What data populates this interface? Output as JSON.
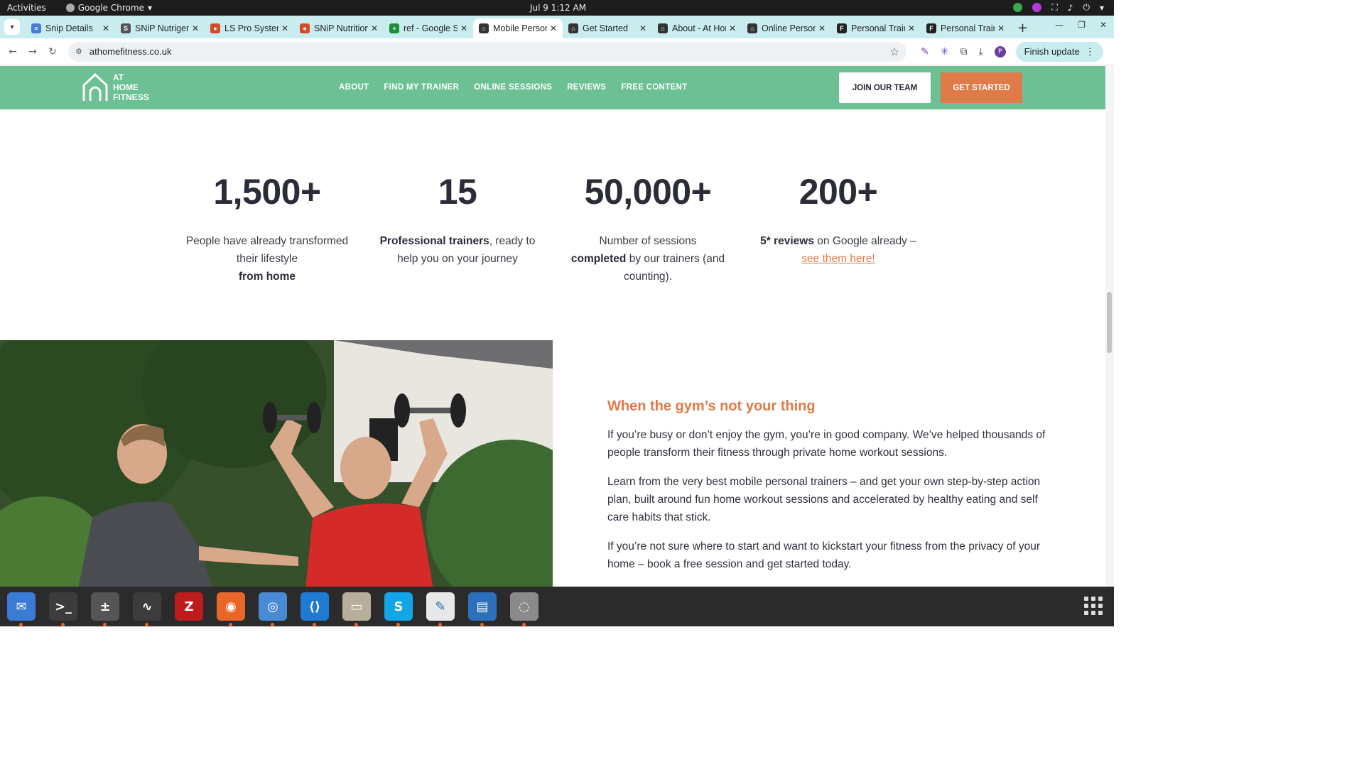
{
  "system": {
    "activities": "Activities",
    "app_name": "Google Chrome",
    "clock": "Jul 9  1:12 AM"
  },
  "tabs": [
    {
      "title": "Snip Details",
      "favicon_color": "#4a7bd4",
      "favicon_glyph": "≡"
    },
    {
      "title": "SNiP Nutrigenomics",
      "favicon_color": "#555555",
      "favicon_glyph": "S"
    },
    {
      "title": "LS Pro Systems",
      "favicon_color": "#d64a2a",
      "favicon_glyph": "●"
    },
    {
      "title": "SNiP Nutrition",
      "favicon_color": "#d64a2a",
      "favicon_glyph": "●"
    },
    {
      "title": "ref - Google Sheets",
      "favicon_color": "#1e8e3e",
      "favicon_glyph": "+"
    },
    {
      "title": "Mobile Personal",
      "favicon_color": "#333333",
      "favicon_glyph": "⌂",
      "active": true
    },
    {
      "title": "Get Started",
      "favicon_color": "#333333",
      "favicon_glyph": "⌂"
    },
    {
      "title": "About - At Home",
      "favicon_color": "#333333",
      "favicon_glyph": "⌂"
    },
    {
      "title": "Online Personal",
      "favicon_color": "#333333",
      "favicon_glyph": "⌂"
    },
    {
      "title": "Personal Trainer",
      "favicon_color": "#222222",
      "favicon_glyph": "F"
    },
    {
      "title": "Personal Trainer",
      "favicon_color": "#222222",
      "favicon_glyph": "F"
    }
  ],
  "browser": {
    "url": "athomefitness.co.uk",
    "finish_update": "Finish update",
    "profile_initial": "P"
  },
  "site": {
    "logo": {
      "line1": "AT",
      "line2": "HOME",
      "line3": "FITNESS"
    },
    "menu": [
      "ABOUT",
      "FIND MY TRAINER",
      "ONLINE SESSIONS",
      "REVIEWS",
      "FREE CONTENT"
    ],
    "join_button": "JOIN OUR TEAM",
    "start_button": "GET STARTED",
    "stats": [
      {
        "number": "1,500+",
        "pre": "People have already transformed their lifestyle",
        "bold": "from home",
        "post": ""
      },
      {
        "number": "15",
        "pre": "",
        "bold": "Professional trainers",
        "post": ", ready to help you on your journey"
      },
      {
        "number": "50,000+",
        "pre": "Number of sessions",
        "bold": "completed",
        "post": "by our trainers (and counting)."
      },
      {
        "number": "200+",
        "pre": "",
        "bold": "5* reviews",
        "post": "on Google already –",
        "link": "see them here!"
      }
    ],
    "section": {
      "heading": "When the gym’s not your thing",
      "p1": "If you’re busy or don’t enjoy the gym, you’re in good company. We’ve helped thousands of people transform their fitness through private home workout sessions.",
      "p2": "Learn from the very best mobile personal trainers – and get your own step-by-step action plan, built around fun home workout sessions and accelerated by healthy eating and self care habits that stick.",
      "p3": "If you’re not sure where to start and want to kickstart your fitness from the privacy of your home – book a free session and get started today."
    }
  },
  "dock": [
    {
      "name": "thunderbird",
      "color": "#3a7bd5",
      "glyph": "✉"
    },
    {
      "name": "terminal",
      "color": "#3c3c3c",
      "glyph": ">_"
    },
    {
      "name": "calculator",
      "color": "#555555",
      "glyph": "±"
    },
    {
      "name": "system-monitor",
      "color": "#3c3c3c",
      "glyph": "∿"
    },
    {
      "name": "filezilla",
      "color": "#bf1b1b",
      "glyph": "Z"
    },
    {
      "name": "firefox",
      "color": "#e8662a",
      "glyph": "◉"
    },
    {
      "name": "chrome",
      "color": "#4a8ad4",
      "glyph": "◎"
    },
    {
      "name": "vscode",
      "color": "#1f7ad4",
      "glyph": "⟨⟩"
    },
    {
      "name": "files",
      "color": "#b8ae9c",
      "glyph": "▭"
    },
    {
      "name": "skype",
      "color": "#12a5e8",
      "glyph": "S"
    },
    {
      "name": "text-editor",
      "color": "#e8e8e8",
      "glyph": "✎"
    },
    {
      "name": "document-viewer",
      "color": "#2c6fbb",
      "glyph": "▤"
    },
    {
      "name": "disks",
      "color": "#8a8a8a",
      "glyph": "◌"
    }
  ]
}
